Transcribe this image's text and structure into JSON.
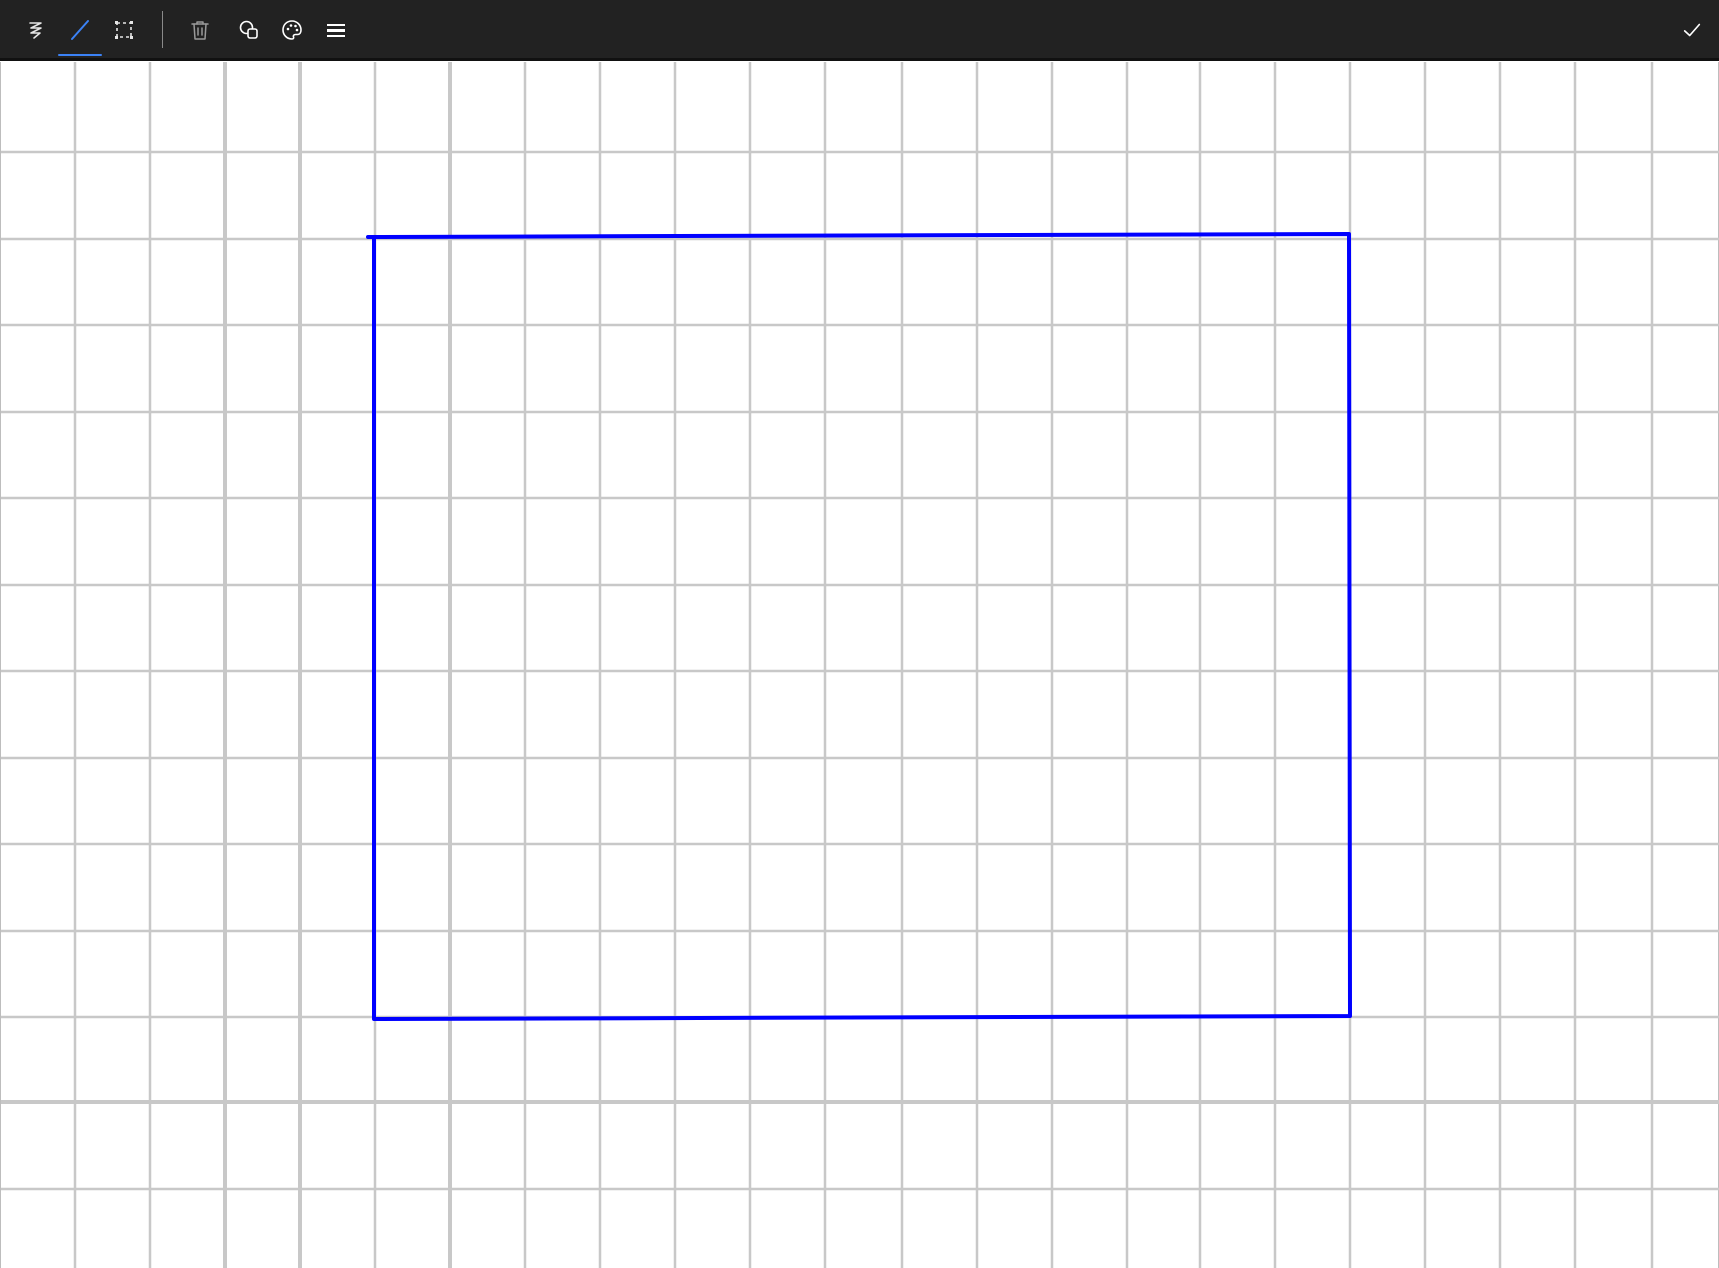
{
  "app": {
    "accent_color": "#3b82f6",
    "toolbar_background": "#222222"
  },
  "toolbar": {
    "tools": [
      {
        "name": "freehand",
        "icon": "squiggle-pen-icon",
        "active": false
      },
      {
        "name": "line",
        "icon": "line-tool-icon",
        "active": true
      },
      {
        "name": "rectangle-select",
        "icon": "dashed-rectangle-icon",
        "active": false
      }
    ],
    "actions": [
      {
        "name": "delete",
        "icon": "trash-icon"
      },
      {
        "name": "shapes",
        "icon": "shapes-icon"
      },
      {
        "name": "color",
        "icon": "palette-icon"
      },
      {
        "name": "stroke-width",
        "icon": "line-weight-icon"
      }
    ],
    "confirm": {
      "icon": "checkmark-icon"
    }
  },
  "canvas": {
    "background": "#ffffff",
    "grid_color": "#c8c8c8",
    "drawing": {
      "stroke_color": "#0000ff",
      "shape": "rectangle"
    }
  }
}
